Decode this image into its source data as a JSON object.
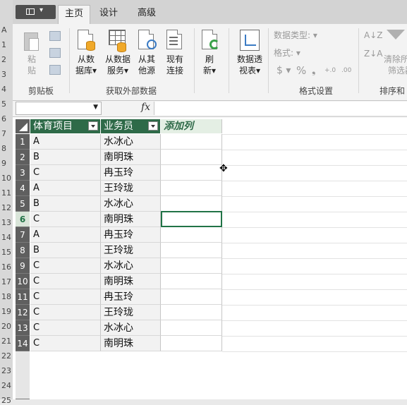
{
  "ribbon_tabs": [
    {
      "label": "主页"
    },
    {
      "label": "设计"
    },
    {
      "label": "高级"
    }
  ],
  "clipboard": {
    "paste_label_line1": "粘",
    "paste_label_line2": "贴",
    "group_label": "剪贴板"
  },
  "external_data": {
    "from_db": {
      "line1": "从数",
      "line2": "据库▾"
    },
    "from_service": {
      "line1": "从数据",
      "line2": "服务▾"
    },
    "from_other": {
      "line1": "从其",
      "line2": "他源"
    },
    "existing": {
      "line1": "现有",
      "line2": "连接"
    },
    "group_label": "获取外部数据"
  },
  "refresh": {
    "line1": "刷",
    "line2": "新▾"
  },
  "pivot": {
    "line1": "数据透",
    "line2": "视表▾"
  },
  "format": {
    "data_type_label": "数据类型: ▾",
    "format_label": "格式: ▾",
    "currency": "$ ▾",
    "percent": "%",
    "comma": "❟",
    "group_label": "格式设置"
  },
  "sort": {
    "clear_line1": "清除所有",
    "clear_line2": "筛选器",
    "group_label": "排序和"
  },
  "formula_bar": {
    "name_box": "",
    "fx": "fx",
    "formula": ""
  },
  "left_strip_marks": [
    "A",
    "1",
    "2",
    "3",
    "4",
    "5",
    "6",
    "7",
    "8",
    "9",
    "10",
    "11",
    "12",
    "13",
    "14",
    "15",
    "16",
    "17",
    "18",
    "19",
    "20",
    "21",
    "22",
    "23",
    "24",
    "25"
  ],
  "table": {
    "headers": [
      "体育项目",
      "业务员",
      "添加列"
    ],
    "rows": [
      {
        "n": "1",
        "sport": "A",
        "staff": "水冰心"
      },
      {
        "n": "2",
        "sport": "B",
        "staff": "南明珠"
      },
      {
        "n": "3",
        "sport": "C",
        "staff": "冉玉玲"
      },
      {
        "n": "4",
        "sport": "A",
        "staff": "王玲珑"
      },
      {
        "n": "5",
        "sport": "B",
        "staff": "水冰心"
      },
      {
        "n": "6",
        "sport": "C",
        "staff": "南明珠"
      },
      {
        "n": "7",
        "sport": "A",
        "staff": "冉玉玲"
      },
      {
        "n": "8",
        "sport": "B",
        "staff": "王玲珑"
      },
      {
        "n": "9",
        "sport": "C",
        "staff": "水冰心"
      },
      {
        "n": "10",
        "sport": "C",
        "staff": "南明珠"
      },
      {
        "n": "11",
        "sport": "C",
        "staff": "冉玉玲"
      },
      {
        "n": "12",
        "sport": "C",
        "staff": "王玲珑"
      },
      {
        "n": "13",
        "sport": "C",
        "staff": "水冰心"
      },
      {
        "n": "14",
        "sport": "C",
        "staff": "南明珠"
      }
    ],
    "selected_row": "6"
  },
  "colors": {
    "header_green": "#2e6a48",
    "accent_green": "#217346"
  }
}
